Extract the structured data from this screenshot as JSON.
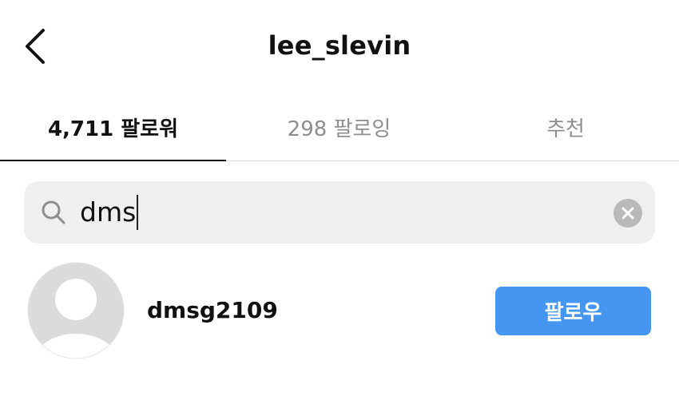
{
  "header": {
    "title": "lee_slevin",
    "back_icon": "chevron-left-icon"
  },
  "tabs": [
    {
      "label": "4,711 팔로워",
      "active": true
    },
    {
      "label": "298 팔로잉",
      "active": false
    },
    {
      "label": "추천",
      "active": false
    }
  ],
  "search": {
    "value": "dms",
    "icon": "search-icon",
    "clear_icon": "clear-icon"
  },
  "results": [
    {
      "username": "dmsg2109",
      "avatar": "default-avatar-icon",
      "follow_label": "팔로우"
    }
  ],
  "colors": {
    "accent": "#4596f0",
    "search_bg": "#efefef",
    "muted_text": "#8e8e8e"
  }
}
